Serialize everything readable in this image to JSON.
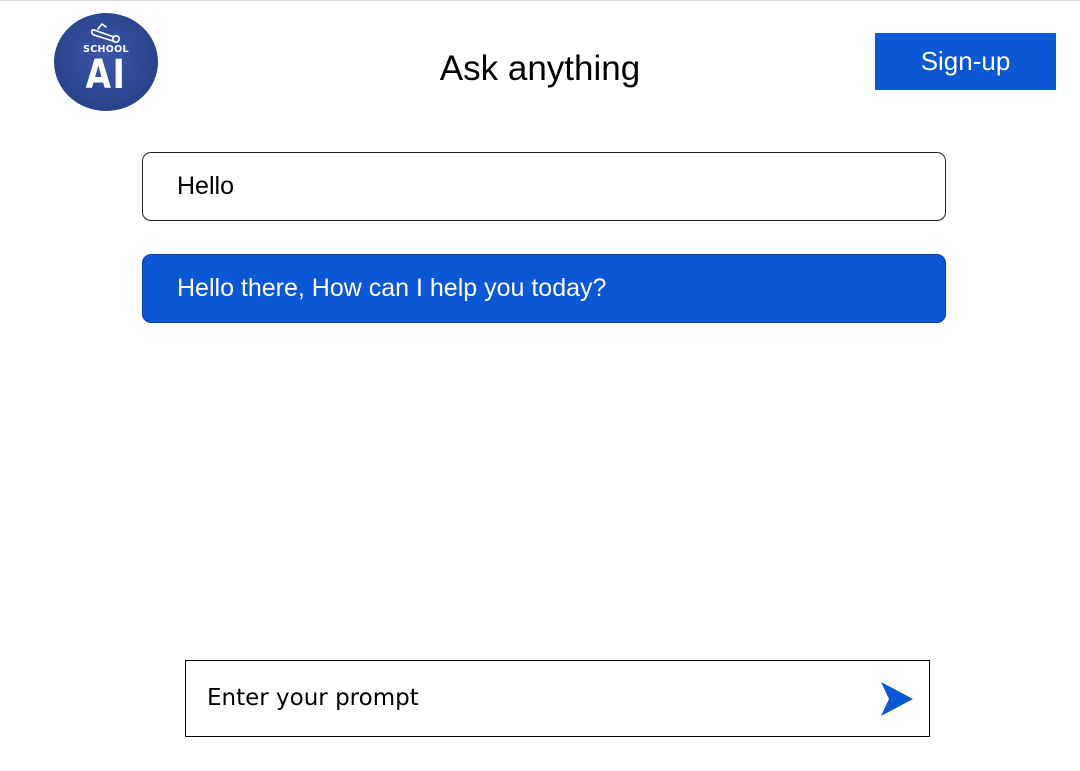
{
  "header": {
    "logo": {
      "icon": "graduation-diploma-icon",
      "word_top": "SCHOOL",
      "word_main": "AI",
      "tagline": "· · · · ·"
    },
    "title": "Ask anything",
    "signup_label": "Sign-up"
  },
  "chat": {
    "messages": [
      {
        "role": "user",
        "text": "Hello"
      },
      {
        "role": "assistant",
        "text": "Hello there, How can I help you today?"
      }
    ]
  },
  "composer": {
    "placeholder": "Enter your prompt",
    "value": "",
    "send_icon": "send-arrow-icon"
  },
  "colors": {
    "accent": "#0b57d6",
    "logo_bg": "#2c4690",
    "text": "#000000",
    "background": "#ffffff"
  }
}
